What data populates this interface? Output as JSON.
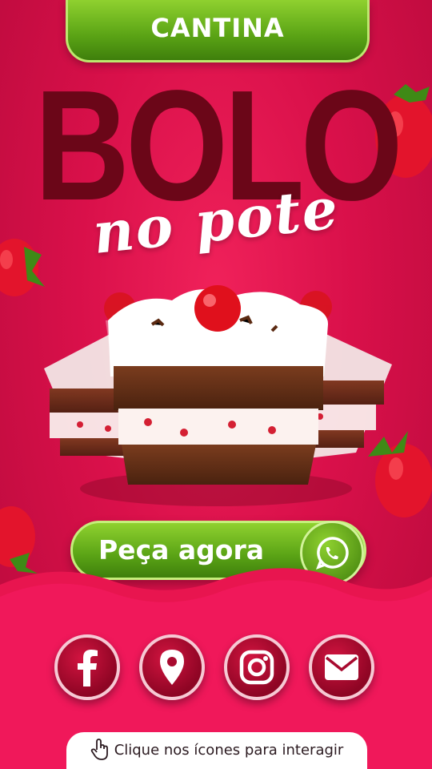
{
  "header": {
    "badge_label": "CANTINA"
  },
  "headline": {
    "title": "BOLO",
    "subtitle": "no pote"
  },
  "cta": {
    "label": "Peça agora",
    "icon": "whatsapp-icon"
  },
  "socials": [
    {
      "icon": "facebook-icon"
    },
    {
      "icon": "location-pin-icon"
    },
    {
      "icon": "instagram-icon"
    },
    {
      "icon": "mail-icon"
    }
  ],
  "hint": {
    "label": "Clique nos ícones para interagir",
    "icon": "hand-pointer-icon"
  },
  "colors": {
    "background": "#d9104a",
    "accent_green": "#5aa315",
    "title_dark": "#6b0618"
  }
}
